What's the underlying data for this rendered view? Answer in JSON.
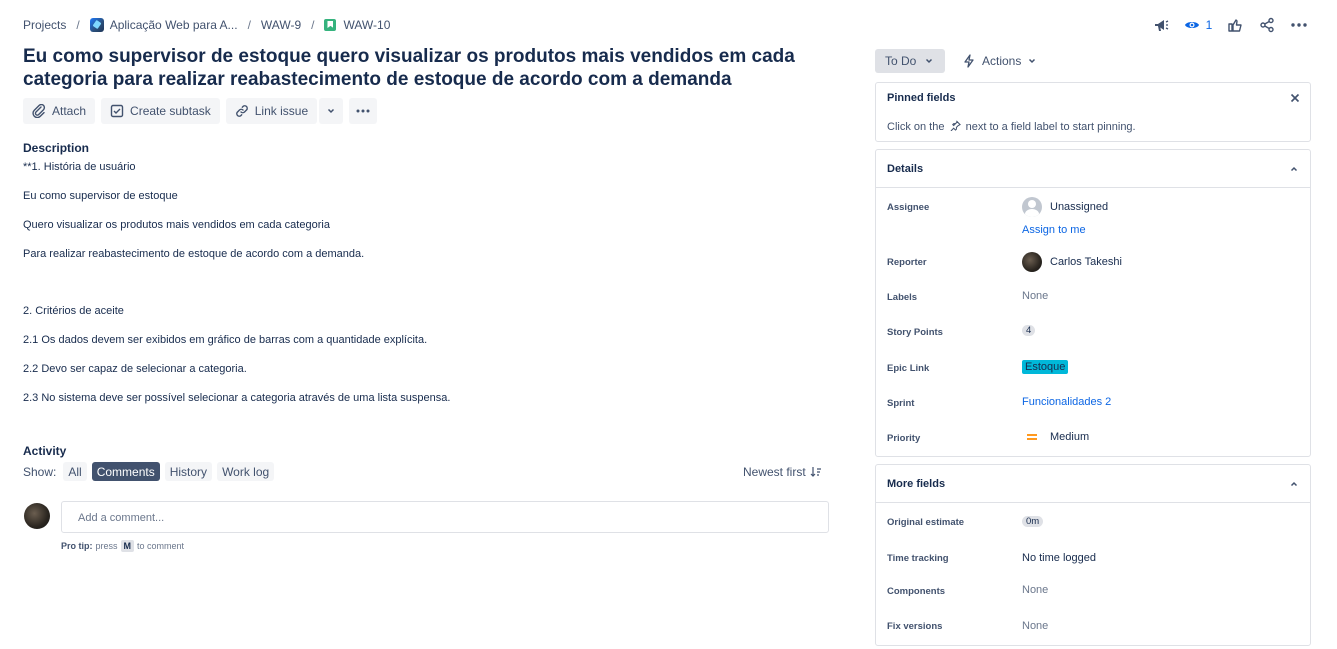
{
  "breadcrumb": {
    "projects": "Projects",
    "project": "Aplicação Web para A...",
    "epic": "WAW-9",
    "issue": "WAW-10",
    "separator": "/"
  },
  "header": {
    "watch_count": "1",
    "icons": [
      "feedback-icon",
      "eye-icon",
      "like-icon",
      "share-icon",
      "more-icon"
    ]
  },
  "title": "Eu como supervisor de estoque quero visualizar os produtos mais vendidos em cada categoria para realizar reabastecimento de estoque de acordo com a demanda",
  "toolbar": {
    "attach": "Attach",
    "create_subtask": "Create subtask",
    "link_issue": "Link issue"
  },
  "description": {
    "label": "Description",
    "lines": [
      "**1. História de usuário",
      "Eu como supervisor de estoque",
      "Quero visualizar os produtos mais vendidos em cada categoria",
      "Para realizar reabastecimento de estoque de acordo com a demanda.",
      "2. Critérios de aceite",
      "2.1 Os dados devem ser exibidos em gráfico de barras com a quantidade explícita.",
      "2.2 Devo ser capaz de selecionar a categoria.",
      "2.3 No sistema deve ser possível selecionar a categoria através de uma lista suspensa."
    ]
  },
  "activity": {
    "label": "Activity",
    "show": "Show:",
    "filters": [
      "All",
      "Comments",
      "History",
      "Work log"
    ],
    "active_filter": "Comments",
    "sort": "Newest first",
    "comment_placeholder": "Add a comment...",
    "protip_label": "Pro tip:",
    "protip_press": "press",
    "protip_key": "M",
    "protip_rest": "to comment"
  },
  "status": {
    "label": "To Do",
    "actions": "Actions"
  },
  "pinned": {
    "title": "Pinned fields",
    "text_before": "Click on the",
    "text_after": "next to a field label to start pinning."
  },
  "details": {
    "title": "Details",
    "assignee_label": "Assignee",
    "assignee": "Unassigned",
    "assign_to_me": "Assign to me",
    "reporter_label": "Reporter",
    "reporter": "Carlos Takeshi",
    "labels_label": "Labels",
    "labels": "None",
    "story_points_label": "Story Points",
    "story_points": "4",
    "epic_link_label": "Epic Link",
    "epic_link": "Estoque",
    "sprint_label": "Sprint",
    "sprint": "Funcionalidades 2",
    "priority_label": "Priority",
    "priority": "Medium"
  },
  "more_fields": {
    "title": "More fields",
    "original_estimate_label": "Original estimate",
    "original_estimate": "0m",
    "time_tracking_label": "Time tracking",
    "time_tracking": "No time logged",
    "components_label": "Components",
    "components": "None",
    "fix_versions_label": "Fix versions",
    "fix_versions": "None"
  },
  "colors": {
    "accent": "#0c66e4",
    "epic": "#00b8d9",
    "priority_medium": "#ff991f",
    "story": "#36b37e"
  }
}
